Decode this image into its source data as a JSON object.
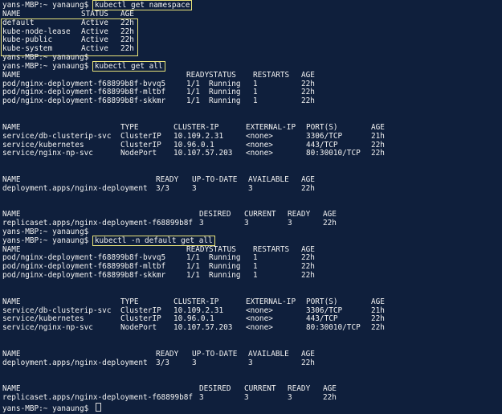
{
  "prompt": "yans-MBP:~ yanaung$",
  "sessions": [
    {
      "command": "kubectl get namespace",
      "boxed": true,
      "output_box": true,
      "header": [
        "NAME",
        "STATUS",
        "AGE"
      ],
      "rows": [
        [
          "default",
          "Active",
          "22h"
        ],
        [
          "kube-node-lease",
          "Active",
          "22h"
        ],
        [
          "kube-public",
          "Active",
          "22h"
        ],
        [
          "kube-system",
          "Active",
          "22h"
        ]
      ]
    },
    {
      "command": "",
      "boxed": false
    },
    {
      "command": "kubectl get all",
      "boxed": true,
      "tables": [
        {
          "header": [
            "NAME",
            "READY",
            "STATUS",
            "RESTARTS",
            "AGE"
          ],
          "rows": [
            [
              "pod/nginx-deployment-f68899b8f-bvvq5",
              "1/1",
              "Running",
              "1",
              "22h"
            ],
            [
              "pod/nginx-deployment-f68899b8f-mltbf",
              "1/1",
              "Running",
              "1",
              "22h"
            ],
            [
              "pod/nginx-deployment-f68899b8f-skkmr",
              "1/1",
              "Running",
              "1",
              "22h"
            ]
          ]
        },
        {
          "header": [
            "NAME",
            "TYPE",
            "CLUSTER-IP",
            "EXTERNAL-IP",
            "PORT(S)",
            "AGE"
          ],
          "rows": [
            [
              "service/db-clusterip-svc",
              "ClusterIP",
              "10.109.2.31",
              "<none>",
              "3306/TCP",
              "21h"
            ],
            [
              "service/kubernetes",
              "ClusterIP",
              "10.96.0.1",
              "<none>",
              "443/TCP",
              "22h"
            ],
            [
              "service/nginx-np-svc",
              "NodePort",
              "10.107.57.203",
              "<none>",
              "80:30010/TCP",
              "22h"
            ]
          ]
        },
        {
          "header": [
            "NAME",
            "READY",
            "UP-TO-DATE",
            "AVAILABLE",
            "AGE"
          ],
          "rows": [
            [
              "deployment.apps/nginx-deployment",
              "3/3",
              "3",
              "3",
              "22h"
            ]
          ]
        },
        {
          "header": [
            "NAME",
            "DESIRED",
            "CURRENT",
            "READY",
            "AGE"
          ],
          "rows": [
            [
              "replicaset.apps/nginx-deployment-f68899b8f",
              "3",
              "3",
              "3",
              "22h"
            ]
          ]
        }
      ]
    },
    {
      "command": "",
      "boxed": false
    },
    {
      "command": "kubectl -n default get all",
      "boxed": true,
      "tables": [
        {
          "header": [
            "NAME",
            "READY",
            "STATUS",
            "RESTARTS",
            "AGE"
          ],
          "rows": [
            [
              "pod/nginx-deployment-f68899b8f-bvvq5",
              "1/1",
              "Running",
              "1",
              "22h"
            ],
            [
              "pod/nginx-deployment-f68899b8f-mltbf",
              "1/1",
              "Running",
              "1",
              "22h"
            ],
            [
              "pod/nginx-deployment-f68899b8f-skkmr",
              "1/1",
              "Running",
              "1",
              "22h"
            ]
          ]
        },
        {
          "header": [
            "NAME",
            "TYPE",
            "CLUSTER-IP",
            "EXTERNAL-IP",
            "PORT(S)",
            "AGE"
          ],
          "rows": [
            [
              "service/db-clusterip-svc",
              "ClusterIP",
              "10.109.2.31",
              "<none>",
              "3306/TCP",
              "21h"
            ],
            [
              "service/kubernetes",
              "ClusterIP",
              "10.96.0.1",
              "<none>",
              "443/TCP",
              "22h"
            ],
            [
              "service/nginx-np-svc",
              "NodePort",
              "10.107.57.203",
              "<none>",
              "80:30010/TCP",
              "22h"
            ]
          ]
        },
        {
          "header": [
            "NAME",
            "READY",
            "UP-TO-DATE",
            "AVAILABLE",
            "AGE"
          ],
          "rows": [
            [
              "deployment.apps/nginx-deployment",
              "3/3",
              "3",
              "3",
              "22h"
            ]
          ]
        },
        {
          "header": [
            "NAME",
            "DESIRED",
            "CURRENT",
            "READY",
            "AGE"
          ],
          "rows": [
            [
              "replicaset.apps/nginx-deployment-f68899b8f",
              "3",
              "3",
              "3",
              "22h"
            ]
          ]
        }
      ]
    }
  ],
  "colors": {
    "background": "#0f1f3c",
    "text": "#f2f2f2",
    "highlight_box": "#e8e27a"
  }
}
